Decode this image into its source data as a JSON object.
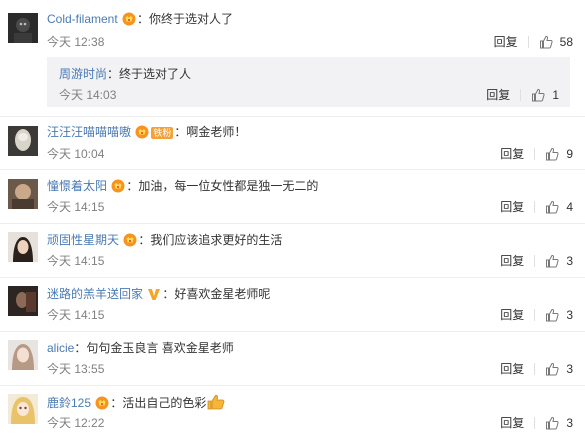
{
  "comments": [
    {
      "username": "Cold-filament",
      "text": "：你终于选对人了",
      "time": "今天 12:38",
      "reply_label": "回复",
      "likes": "58",
      "badge": "vip",
      "sub_reply": {
        "username": "周游时尚",
        "text": "：终于选对了人",
        "time": "今天 14:03",
        "reply_label": "回复",
        "likes": "1"
      }
    },
    {
      "username": "汪汪汪喵喵喵嗷",
      "text": "：啊金老师！",
      "time": "今天 10:04",
      "reply_label": "回复",
      "likes": "9",
      "badge": "vip+fan",
      "fan_label": "铁粉"
    },
    {
      "username": "憧憬着太阳",
      "text": "：加油，每一位女性都是独一无二的",
      "time": "今天 14:15",
      "reply_label": "回复",
      "likes": "4",
      "badge": "vip"
    },
    {
      "username": "顽固性星期天",
      "text": "：我们应该追求更好的生活",
      "time": "今天 14:15",
      "reply_label": "回复",
      "likes": "3",
      "badge": "vip"
    },
    {
      "username": "迷路的羔羊送回家",
      "text": "：好喜欢金星老师呢",
      "time": "今天 14:15",
      "reply_label": "回复",
      "likes": "3",
      "badge": "verified"
    },
    {
      "username": "alicie",
      "text": "：句句金玉良言 喜欢金星老师",
      "time": "今天 13:55",
      "reply_label": "回复",
      "likes": "3",
      "badge": "none"
    },
    {
      "username": "鹿鈴125",
      "text": "：活出自己的色彩",
      "time": "今天 12:22",
      "reply_label": "回复",
      "likes": "3",
      "badge": "vip",
      "emoji": "thumbs-up"
    }
  ],
  "colors": {
    "username": "#4b7ab4",
    "text": "#333333",
    "time": "#808080",
    "subreply_bg": "#f2f2f5",
    "divider": "#eeeeee",
    "verified": "#f5a623",
    "vip_badge": "#f7931e"
  }
}
